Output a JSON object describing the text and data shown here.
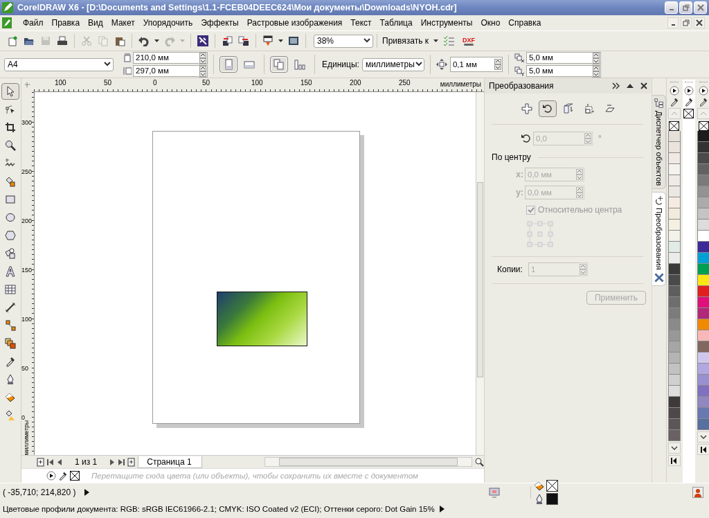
{
  "title_bar": {
    "title": "CorelDRAW X6 - [D:\\Documents and Settings\\1.1-FCEB04DEEC624\\Мои документы\\Downloads\\NYOH.cdr]"
  },
  "menu_bar": {
    "items": [
      "Файл",
      "Правка",
      "Вид",
      "Макет",
      "Упорядочить",
      "Эффекты",
      "Растровые изображения",
      "Текст",
      "Таблица",
      "Инструменты",
      "Окно",
      "Справка"
    ]
  },
  "toolbar": {
    "groups": [
      {
        "items": [
          {
            "kind": "new",
            "disabled": false
          },
          {
            "kind": "open",
            "disabled": false
          },
          {
            "kind": "save",
            "disabled": true
          },
          {
            "kind": "print",
            "disabled": false
          }
        ]
      },
      {
        "items": [
          {
            "kind": "cut",
            "disabled": true
          },
          {
            "kind": "copy",
            "disabled": true
          },
          {
            "kind": "paste",
            "disabled": false
          }
        ]
      },
      {
        "items": [
          {
            "kind": "undo",
            "disabled": false
          },
          {
            "kind": "caret",
            "disabled": false
          },
          {
            "kind": "redo",
            "disabled": true
          },
          {
            "kind": "caret",
            "disabled": true
          }
        ]
      },
      {
        "items": [
          {
            "kind": "search-content",
            "disabled": false
          }
        ]
      },
      {
        "items": [
          {
            "kind": "import",
            "disabled": false
          },
          {
            "kind": "export",
            "disabled": false
          }
        ]
      },
      {
        "items": [
          {
            "kind": "publish",
            "disabled": false
          },
          {
            "kind": "caret",
            "disabled": false
          },
          {
            "kind": "welcome",
            "disabled": false
          }
        ]
      }
    ],
    "zoom": "38%",
    "snap": "Привязать к",
    "dxf": "DXF"
  },
  "property_bar": {
    "page_size": "A4",
    "width": "210,0 мм",
    "height": "297,0 мм",
    "orientation": [
      {
        "kind": "portrait",
        "selected": true
      },
      {
        "kind": "landscape",
        "selected": false
      }
    ],
    "page_scope": [
      {
        "kind": "all-pages",
        "selected": true
      },
      {
        "kind": "current-page",
        "selected": false
      }
    ],
    "units_label": "Единицы:",
    "units": "миллиметры",
    "nudge": "0,1 мм",
    "dup_x": "5,0 мм",
    "dup_y": "5,0 мм"
  },
  "toolbox": [
    {
      "kind": "pick",
      "selected": true
    },
    {
      "kind": "shape",
      "selected": false
    },
    {
      "kind": "crop",
      "selected": false
    },
    {
      "kind": "zoom",
      "selected": false
    },
    {
      "kind": "freehand",
      "selected": false
    },
    {
      "kind": "smart-fill",
      "selected": false
    },
    {
      "kind": "rectangle",
      "selected": false
    },
    {
      "kind": "ellipse",
      "selected": false
    },
    {
      "kind": "polygon",
      "selected": false
    },
    {
      "kind": "basic-shapes",
      "selected": false
    },
    {
      "kind": "text",
      "selected": false
    },
    {
      "kind": "table",
      "selected": false
    },
    {
      "kind": "dimension",
      "selected": false
    },
    {
      "kind": "connector",
      "selected": false
    },
    {
      "kind": "blend",
      "selected": false
    },
    {
      "kind": "eyedropper",
      "selected": false
    },
    {
      "kind": "outline",
      "selected": false
    },
    {
      "kind": "fill",
      "selected": false
    },
    {
      "kind": "interactive-fill",
      "selected": false
    }
  ],
  "rulers": {
    "h_labels": [
      "100",
      "50",
      "0",
      "50",
      "100",
      "150",
      "200",
      "250"
    ],
    "h_unit": "миллиметры",
    "v_labels": [
      "300",
      "250",
      "200",
      "150",
      "100",
      "50",
      "0"
    ],
    "v_unit": "миллиметры"
  },
  "page_nav": {
    "counter": "1 из 1",
    "tabs": [
      {
        "label": "Страница 1",
        "selected": true
      }
    ]
  },
  "docker": {
    "title": "Преобразования",
    "modes": [
      {
        "kind": "position",
        "selected": false
      },
      {
        "kind": "rotate",
        "selected": true
      },
      {
        "kind": "scale",
        "selected": false
      },
      {
        "kind": "size",
        "selected": false
      },
      {
        "kind": "skew",
        "selected": false
      }
    ],
    "inputs_disabled": true,
    "angle": "0,0",
    "degree": "°",
    "center_label": "По центру",
    "x_label": "x:",
    "x": "0,0 мм",
    "y_label": "y:",
    "y": "0,0 мм",
    "relative": {
      "label": "Относительно центра",
      "checked": true,
      "disabled": true
    },
    "copies_label": "Копии:",
    "copies": "1",
    "apply": {
      "label": "Применить",
      "disabled": true
    },
    "side_tabs": [
      {
        "kind": "objects",
        "label": "Диспетчер объектов",
        "selected": false
      },
      {
        "kind": "transform",
        "label": "Преобразования",
        "selected": true
      }
    ]
  },
  "palettes": [
    {
      "swatches": [
        {
          "kind": "none"
        },
        {
          "color": "#e6e0da"
        },
        {
          "color": "#ebe4dc"
        },
        {
          "color": "#f0e9e4"
        },
        {
          "color": "#f5f2ee"
        },
        {
          "color": "#efeae6"
        },
        {
          "color": "#ebe8e4"
        },
        {
          "color": "#f5ebe2"
        },
        {
          "color": "#f2ebdc"
        },
        {
          "color": "#f4f0e2"
        },
        {
          "color": "#f2f2e8"
        },
        {
          "color": "#e2ece6"
        },
        {
          "color": "#ebebeb"
        },
        {
          "color": "#3a3a3a"
        },
        {
          "color": "#4a4a4a"
        },
        {
          "color": "#5e5e5e"
        },
        {
          "color": "#6e6e6e"
        },
        {
          "color": "#7c7c7c"
        },
        {
          "color": "#8a8a8a"
        },
        {
          "color": "#989898"
        },
        {
          "color": "#a6a6a6"
        },
        {
          "color": "#b4b4b4"
        },
        {
          "color": "#c2c2c2"
        },
        {
          "color": "#d0d0d0"
        },
        {
          "color": "#dedede"
        },
        {
          "color": "#3e3a3a"
        },
        {
          "color": "#4e4848"
        },
        {
          "color": "#5c5656"
        },
        {
          "color": "#6a6262"
        }
      ]
    },
    {
      "swatches": [
        {
          "kind": "none"
        }
      ]
    },
    {
      "swatches": [
        {
          "kind": "none"
        },
        {
          "color": "#1c1c1c"
        },
        {
          "color": "#333333"
        },
        {
          "color": "#4a4a4a"
        },
        {
          "color": "#626262"
        },
        {
          "color": "#7a7a7a"
        },
        {
          "color": "#939393"
        },
        {
          "color": "#ababab"
        },
        {
          "color": "#c4c4c4"
        },
        {
          "color": "#dcdcdc"
        },
        {
          "color": "#ffffff"
        },
        {
          "color": "#3c2a98"
        },
        {
          "color": "#00a0d6"
        },
        {
          "color": "#00a050"
        },
        {
          "color": "#ffe614"
        },
        {
          "color": "#e02020"
        },
        {
          "color": "#e0107a"
        },
        {
          "color": "#b02878"
        },
        {
          "color": "#f08a00"
        },
        {
          "color": "#f6b8b8"
        },
        {
          "color": "#806860"
        },
        {
          "color": "#cfc8ec"
        },
        {
          "color": "#b0a8e0"
        },
        {
          "color": "#9890d0"
        },
        {
          "color": "#8070c0"
        },
        {
          "color": "#9088c0"
        },
        {
          "color": "#6878b0"
        },
        {
          "color": "#5670a0"
        }
      ]
    }
  ],
  "document_palette": {
    "hint": "Перетащите сюда цвета (или объекты), чтобы сохранить их вместе с документом"
  },
  "status_bar": {
    "coords": "( -35,710; 214,820 )",
    "profiles": "Цветовые профили документа: RGB: sRGB IEC61966-2.1; CMYK: ISO Coated v2 (ECI); Оттенки серого: Dot Gain 15%"
  }
}
